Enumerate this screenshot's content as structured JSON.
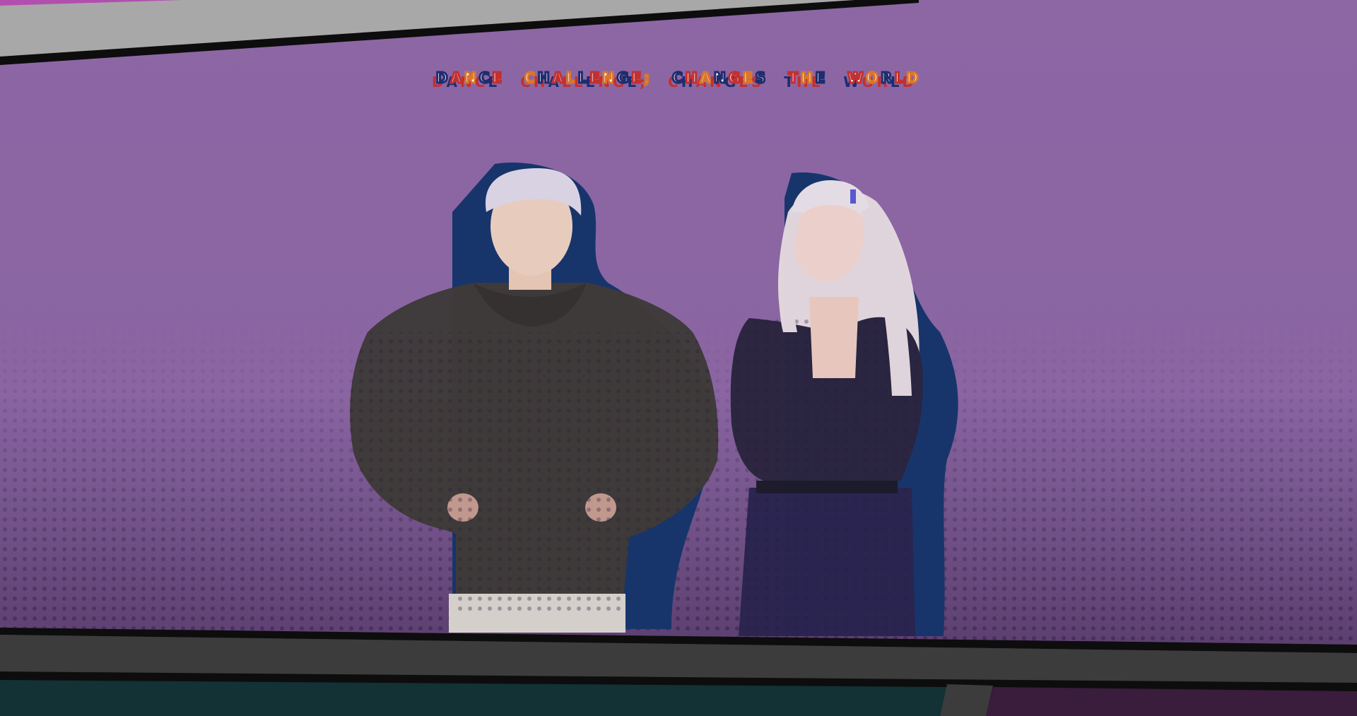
{
  "scene": {
    "title": "DANCE CHALLENGE; CHANGES THE WORLD",
    "colors": {
      "panel_bg_top": "#8c67a4",
      "panel_bg_bottom": "#4f3563",
      "halftone_dot": "#2b1b3a",
      "frame_border": "#0d0d0d",
      "gutter": "#3c3c3c",
      "top_strip": "#a8a8a8",
      "figure_shadow": "#17356b",
      "title_red": "#c23030",
      "title_navy": "#1f2c6e",
      "title_orange": "#d9762a",
      "lower_left_panel": "#123235",
      "lower_right_panel": "#3a1c3c"
    },
    "figures": [
      {
        "name": "left-person",
        "description_icon": "person-icon"
      },
      {
        "name": "right-person",
        "description_icon": "person-icon"
      }
    ]
  }
}
